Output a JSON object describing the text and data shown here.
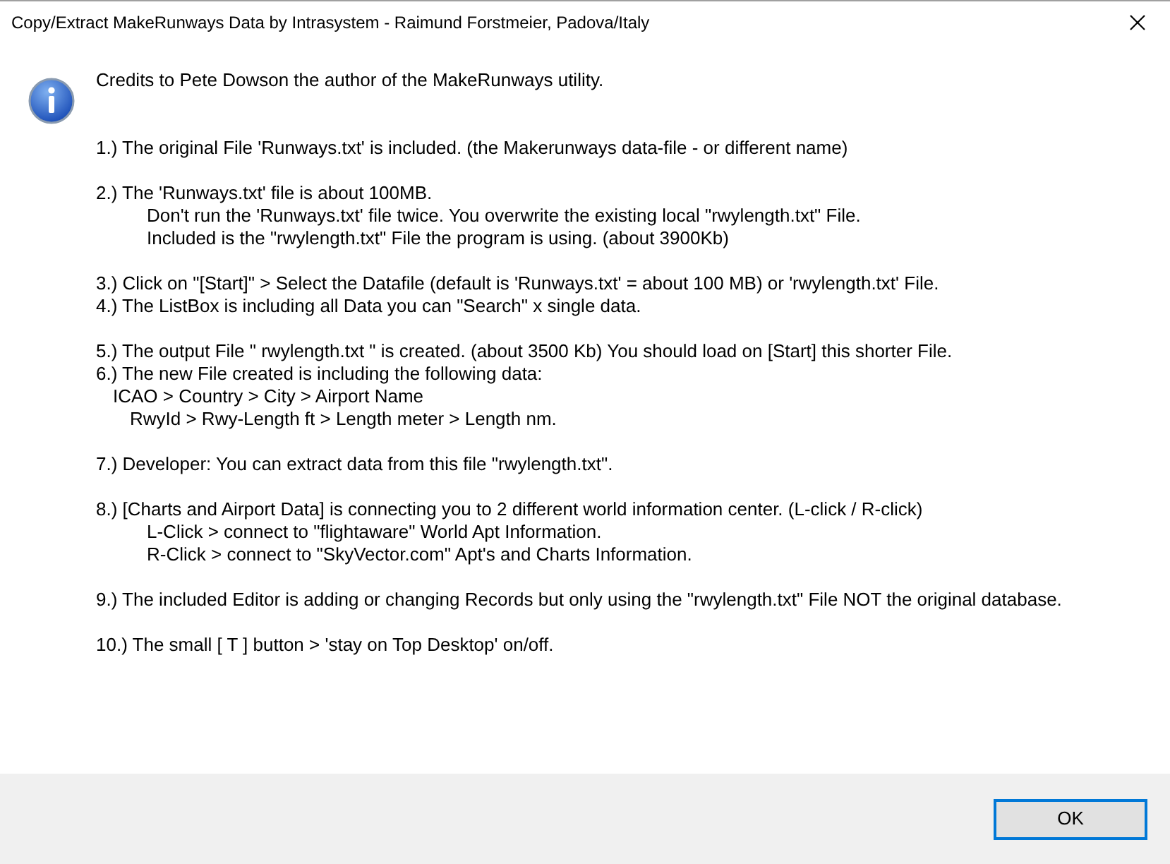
{
  "window": {
    "title": "Copy/Extract MakeRunways Data by Intrasystem - Raimund Forstmeier, Padova/Italy"
  },
  "credits": "Credits to Pete Dowson the author of the MakeRunways utility.",
  "groups": [
    [
      {
        "text": "1.) The original File 'Runways.txt' is included. (the Makerunways data-file - or different name)"
      }
    ],
    [
      {
        "text": "2.) The 'Runways.txt' file is about 100MB.",
        "children": [
          {
            "kind": "note",
            "text": "Don't run the 'Runways.txt' file twice. You overwrite the existing local \"rwylength.txt\" File."
          },
          {
            "kind": "note",
            "text": "Included is the \"rwylength.txt\" File the program is using. (about 3900Kb)"
          }
        ]
      }
    ],
    [
      {
        "text": "3.) Click on \"[Start]\" > Select the Datafile (default is 'Runways.txt' = about 100 MB) or 'rwylength.txt' File."
      },
      {
        "text": "4.) The ListBox is including all Data you can \"Search\" x single data."
      }
    ],
    [
      {
        "text": "5.) The output File \" rwylength.txt \" is created. (about 3500 Kb) You should load on [Start] this shorter File."
      },
      {
        "text": "6.) The new File created is including the following data:",
        "children": [
          {
            "kind": "fields",
            "text": "ICAO > Country > City > Airport Name",
            "children": [
              {
                "kind": "fields",
                "text": "RwyId > Rwy-Length ft > Length meter > Length nm."
              }
            ]
          }
        ]
      }
    ],
    [
      {
        "text": "7.) Developer: You can extract data from this file \"rwylength.txt\"."
      }
    ],
    [
      {
        "text": "8.) [Charts and Airport Data] is connecting you to 2 different world information center. (L-click / R-click)",
        "children": [
          {
            "kind": "note",
            "text": "L-Click > connect to \"flightaware\" World Apt Information."
          },
          {
            "kind": "note",
            "text": "R-Click > connect to \"SkyVector.com\" Apt's and Charts Information."
          }
        ]
      }
    ],
    [
      {
        "text": "9.) The included Editor is adding or changing Records but only using the \"rwylength.txt\" File NOT the original database."
      }
    ],
    [
      {
        "text": "10.) The small [ T ] button > 'stay on Top Desktop' on/off."
      }
    ]
  ],
  "buttons": [
    {
      "label": "OK",
      "selected": true
    }
  ]
}
